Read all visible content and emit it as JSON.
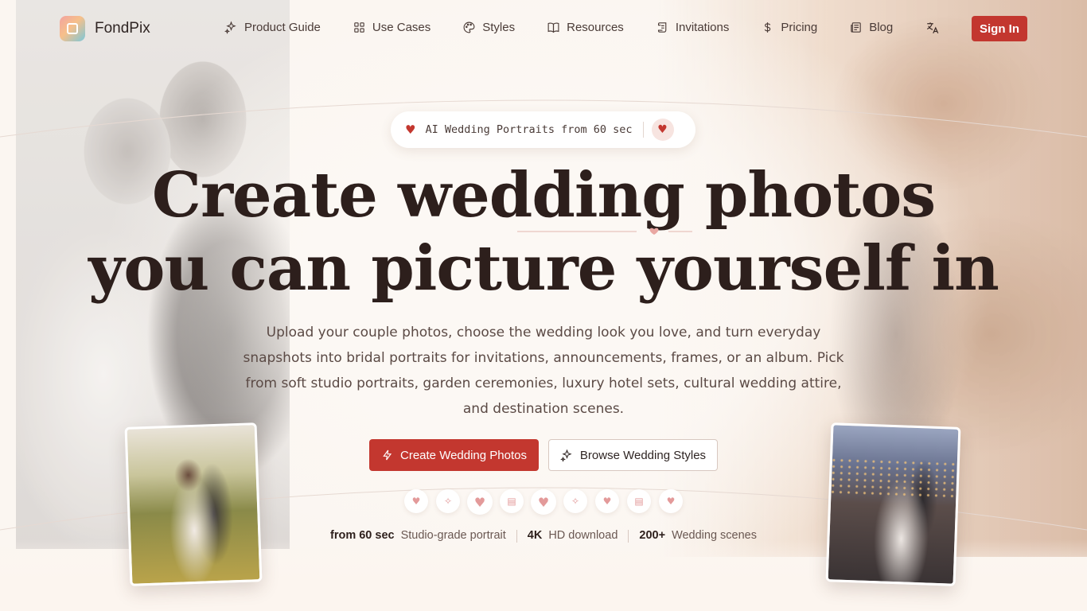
{
  "brand": {
    "name": "FondPix"
  },
  "nav": {
    "items": [
      {
        "label": "Product Guide",
        "icon": "sparkles-icon"
      },
      {
        "label": "Use Cases",
        "icon": "grid-icon"
      },
      {
        "label": "Styles",
        "icon": "palette-icon"
      },
      {
        "label": "Resources",
        "icon": "book-icon"
      },
      {
        "label": "Invitations",
        "icon": "scroll-icon"
      },
      {
        "label": "Pricing",
        "icon": "dollar-icon"
      },
      {
        "label": "Blog",
        "icon": "newspaper-icon"
      }
    ],
    "language_icon": "translate-icon",
    "sign_in": "Sign In"
  },
  "hero": {
    "badge": "AI Wedding Portraits from 60 sec",
    "headline_line1": "Create wedding photos",
    "headline_line2": "you can picture yourself in",
    "subtitle": "Upload your couple photos, choose the wedding look you love, and turn everyday snapshots into bridal portraits for invitations, announcements, frames, or an album. Pick from soft studio portraits, garden ceremonies, luxury hotel sets, cultural wedding attire, and destination scenes.",
    "primary_cta": "Create Wedding Photos",
    "secondary_cta": "Browse Wedding Styles"
  },
  "icon_row": [
    "heart-icon",
    "sparkles-icon",
    "heart-icon",
    "scroll-icon",
    "heart-icon",
    "sparkles-icon",
    "heart-icon",
    "scroll-icon",
    "heart-icon"
  ],
  "stats": [
    {
      "value": "from 60 sec",
      "label": "Studio-grade portrait"
    },
    {
      "value": "4K",
      "label": "HD download"
    },
    {
      "value": "200+",
      "label": "Wedding scenes"
    }
  ],
  "colors": {
    "accent": "#c3372f",
    "heading": "#2d1f1c",
    "body": "#5b4a45",
    "background": "#fbf6f1"
  }
}
